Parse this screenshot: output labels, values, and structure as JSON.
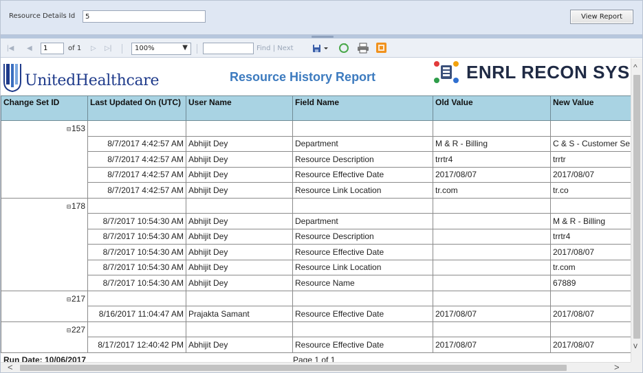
{
  "parameters": {
    "resource_details_label": "Resource Details Id",
    "resource_details_value": "5",
    "view_report_label": "View Report"
  },
  "toolbar": {
    "page_value": "1",
    "of_text": "of 1",
    "zoom_value": "100%",
    "find_label": "Find",
    "separator": "|",
    "next_label": "Next"
  },
  "header": {
    "uhc_logo_text": "UnitedHealthcare",
    "report_title": "Resource History Report",
    "enrl_logo_text": "ENRL RECON SYS"
  },
  "columns": [
    "Change Set ID",
    "Last Updated On (UTC)",
    "User Name",
    "Field Name",
    "Old Value",
    "New Value"
  ],
  "groups": [
    {
      "id": "153",
      "rows": [
        {
          "date": "8/7/2017 4:42:57 AM",
          "user": "Abhijit Dey",
          "field": "Department",
          "old": "M & R - Billing",
          "new": "C & S - Customer Se"
        },
        {
          "date": "8/7/2017 4:42:57 AM",
          "user": "Abhijit Dey",
          "field": "Resource Description",
          "old": "trrtr4",
          "new": "trrtr"
        },
        {
          "date": "8/7/2017 4:42:57 AM",
          "user": "Abhijit Dey",
          "field": "Resource Effective Date",
          "old": "2017/08/07",
          "new": "2017/08/07"
        },
        {
          "date": "8/7/2017 4:42:57 AM",
          "user": "Abhijit Dey",
          "field": "Resource Link Location",
          "old": "tr.com",
          "new": "tr.co"
        }
      ]
    },
    {
      "id": "178",
      "rows": [
        {
          "date": "8/7/2017 10:54:30 AM",
          "user": "Abhijit Dey",
          "field": "Department",
          "old": "",
          "new": "M & R - Billing"
        },
        {
          "date": "8/7/2017 10:54:30 AM",
          "user": "Abhijit Dey",
          "field": "Resource Description",
          "old": "",
          "new": "trrtr4"
        },
        {
          "date": "8/7/2017 10:54:30 AM",
          "user": "Abhijit Dey",
          "field": "Resource Effective Date",
          "old": "",
          "new": "2017/08/07"
        },
        {
          "date": "8/7/2017 10:54:30 AM",
          "user": "Abhijit Dey",
          "field": "Resource Link Location",
          "old": "",
          "new": "tr.com"
        },
        {
          "date": "8/7/2017 10:54:30 AM",
          "user": "Abhijit Dey",
          "field": "Resource Name",
          "old": "",
          "new": "67889"
        }
      ]
    },
    {
      "id": "217",
      "rows": [
        {
          "date": "8/16/2017 11:04:47 AM",
          "user": "Prajakta Samant",
          "field": "Resource Effective Date",
          "old": "2017/08/07",
          "new": "2017/08/07"
        }
      ]
    },
    {
      "id": "227",
      "rows": [
        {
          "date": "8/17/2017 12:40:42 PM",
          "user": "Abhijit Dey",
          "field": "Resource Effective Date",
          "old": "2017/08/07",
          "new": "2017/08/07"
        }
      ]
    }
  ],
  "expander_symbol": "⊟",
  "footer": {
    "run_date": "Run Date: 10/06/2017",
    "page_info": "Page 1 of 1"
  },
  "colors": {
    "header_bg": "#a9d3e3",
    "title_blue": "#3d7bbf",
    "uhc_blue": "#1e3a8a",
    "param_bg": "#dfe7f3"
  }
}
